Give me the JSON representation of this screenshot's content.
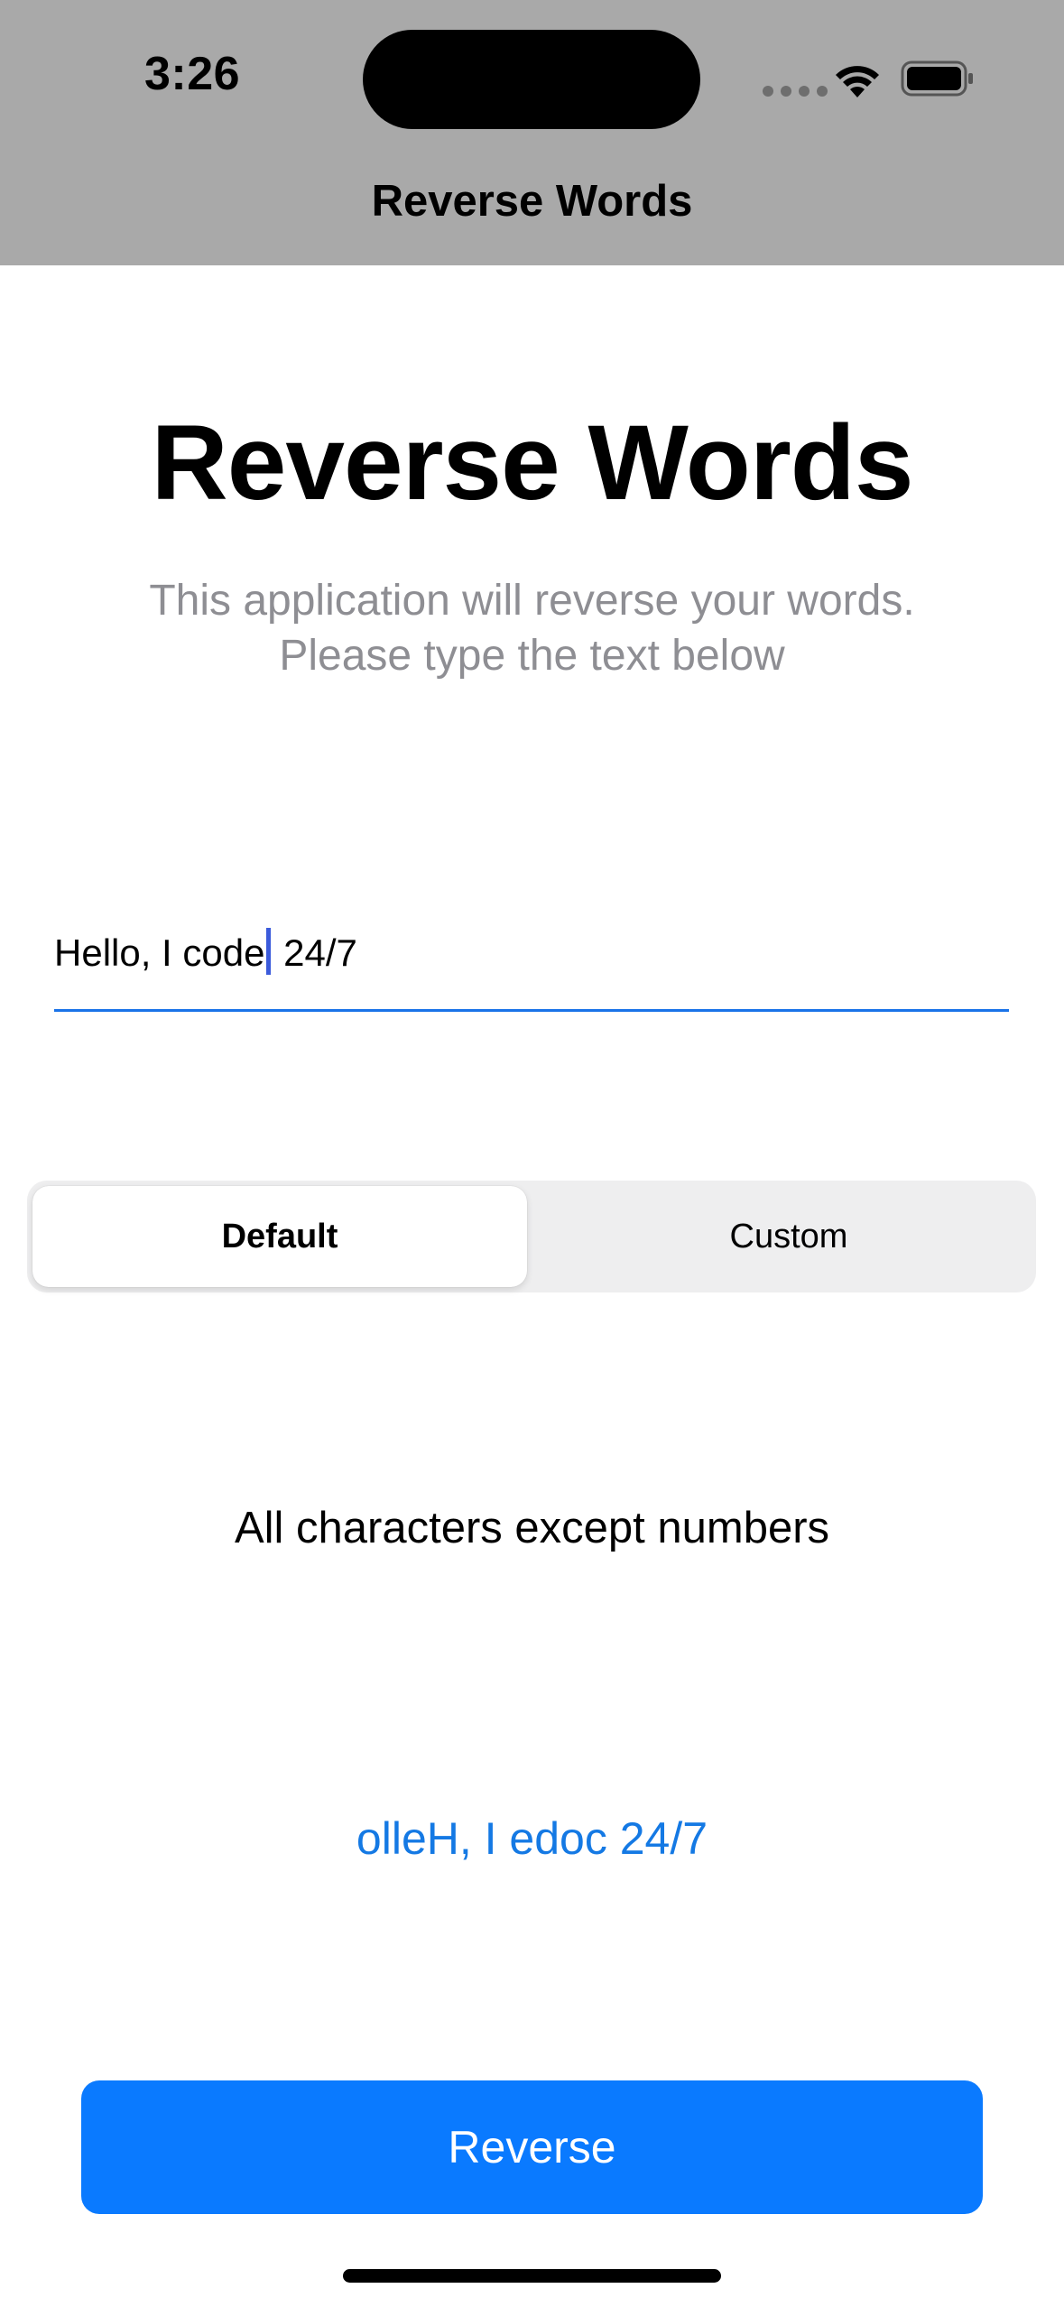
{
  "status_bar": {
    "time": "3:26",
    "icons": [
      "signal-dots-icon",
      "wifi-icon",
      "battery-icon"
    ]
  },
  "nav": {
    "title": "Reverse Words"
  },
  "main": {
    "title": "Reverse Words",
    "subtitle_line1": "This application will reverse your words.",
    "subtitle_line2": "Please type the text below",
    "input": {
      "value_before_caret": "Hello, I code",
      "value_after_caret": " 24/7"
    },
    "segments": [
      {
        "label": "Default",
        "selected": true
      },
      {
        "label": "Custom",
        "selected": false
      }
    ],
    "mode_description": "All characters except numbers",
    "result": "olleH, I edoc 24/7",
    "reverse_button_label": "Reverse"
  },
  "colors": {
    "header_bg": "#a9a9a9",
    "accent": "#0a7aff",
    "result_text": "#1479e4",
    "subtitle_text": "#8e8e93"
  }
}
